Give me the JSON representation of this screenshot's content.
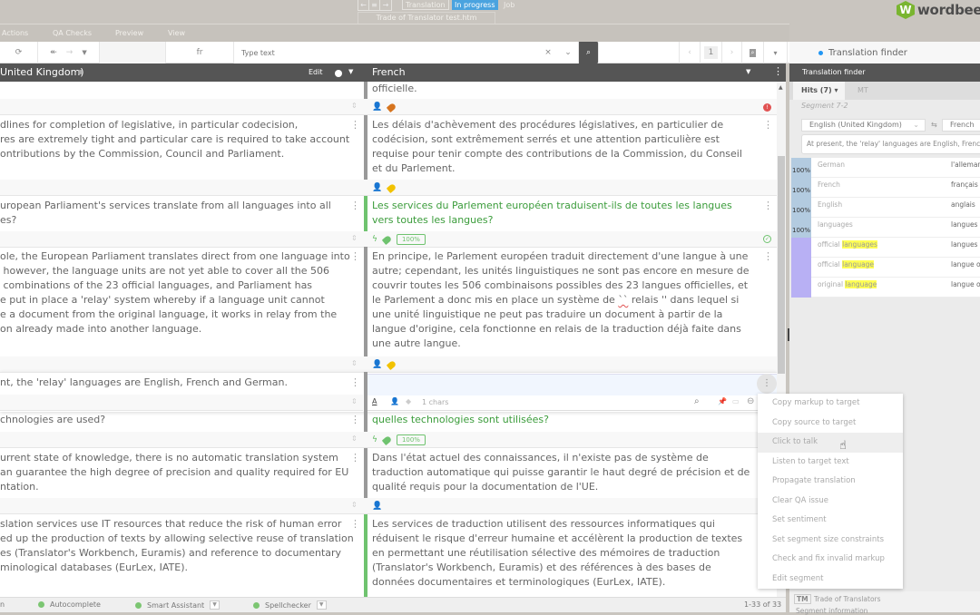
{
  "topbar": {
    "nav_prev": "←",
    "nav_list": "≡",
    "nav_next": "→",
    "workflow": "Translation",
    "status": "In progress",
    "job": "Job",
    "document_tab": "Trade of Translator test.htm",
    "logo_text": "wordbee",
    "logo_tm": "™"
  },
  "menu": [
    "Actions",
    "QA Checks",
    "Preview",
    "View"
  ],
  "toolbar": {
    "lang_code": "fr",
    "search_placeholder": "Type text",
    "clear": "×",
    "dropdown": "⌄",
    "search_icon": "🔍",
    "prev_page": "‹",
    "page": "1",
    "next_page": "›",
    "more": "▾"
  },
  "grid": {
    "source_header": "United Kingdom)",
    "edit_label": "Edit",
    "target_header": "French",
    "rows": [
      {
        "source": "",
        "target": "officielle.",
        "target_style": "normal",
        "footer": {
          "tag_color": "#d6741e",
          "status": "error"
        }
      },
      {
        "source": "dlines for completion of legislative, in particular codecision,\nres are extremely tight and particular care is required to take account\nontributions by the Commission, Council and Parliament.",
        "target": "Les délais d'achèvement des procédures législatives, en particulier de codécision, sont extrêmement serrés et une attention particulière est requise pour tenir compte des contributions de la Commission, du Conseil et du Parlement.",
        "target_style": "normal",
        "footer": {
          "tag_color": "#f2c200"
        }
      },
      {
        "source": "uropean Parliament's services translate from all languages into all\nes?",
        "target": "Les services du Parlement européen traduisent-ils de toutes les langues vers toutes les langues?",
        "target_style": "green",
        "footer": {
          "tag_color": "#6fc36f",
          "match": "100%",
          "status": "confirmed"
        }
      },
      {
        "source": "ole, the European Parliament translates direct from one language into\n however, the language units are not yet able to cover all the 506\n combinations of the 23 official languages, and Parliament has\ne put in place a 'relay' system whereby if a language unit cannot\ne a document from the original language, it works in relay from the\non already made into another language.",
        "target_pre": "En principe, le Parlement européen traduit directement d'une langue à une autre; cependant, les unités linguistiques ne sont pas encore en mesure de couvrir toutes les 506 combinaisons possibles des 23 langues officielles, et le Parlement a donc mis en place un système de ",
        "target_squig": "``",
        "target_post": " relais '' dans lequel si une unité linguistique ne peut pas traduire un document à partir de la langue d'origine, cela fonctionne en relais de la traduction déjà faite dans une autre langue.",
        "target_style": "normal",
        "footer": {
          "tag_color": "#f2c200"
        }
      },
      {
        "source": "nt, the 'relay' languages are English, French and German.",
        "target": "",
        "target_style": "editing",
        "footer": {
          "chars": "1 chars"
        }
      },
      {
        "source": "chnologies are used?",
        "target": "quelles technologies sont utilisées?",
        "target_style": "green",
        "footer": {
          "tag_color": "#6fc36f",
          "match": "100%"
        }
      },
      {
        "source": "urrent state of knowledge, there is no automatic translation system\nan guarantee the high degree of precision and quality required for EU\nntation.",
        "target": "Dans l'état actuel des connaissances, il n'existe pas de système de traduction automatique qui puisse garantir le haut degré de précision et de qualité requis pour la documentation de l'UE.",
        "target_style": "normal",
        "footer": {}
      },
      {
        "source": "slation services use IT resources that reduce the risk of human error\ned up the production of texts by allowing selective reuse of translation\nes (Translator's Workbench, Euramis) and reference to documentary\nminological databases (EurLex, IATE).",
        "target": "Les services de traduction utilisent des ressources informatiques qui réduisent le risque d'erreur humaine et accélèrent la production de textes en permettant une réutilisation sélective des mémoires de traduction (Translator's Workbench, Euramis) et des références à des bases de données documentaires et terminologiques (EurLex, IATE).",
        "target_style": "normal",
        "footer": {}
      }
    ]
  },
  "finder": {
    "tab_label": "Translation finder",
    "header": "Translation finder",
    "hits_tab": "Hits (7) ▾",
    "mt_tab": "MT",
    "segment": "Segment 7-2",
    "source_lang": "English (United Kingdom)",
    "target_lang": "French",
    "query": "At present, the 'relay' languages are English, French and German.",
    "hits": [
      {
        "score": "100%",
        "source": "German",
        "target": "l'allemand",
        "kind": "tm"
      },
      {
        "score": "100%",
        "source": "French",
        "target": "français",
        "kind": "tm"
      },
      {
        "score": "100%",
        "source": "English",
        "target": "anglais",
        "kind": "tm"
      },
      {
        "score": "100%",
        "source": "languages",
        "target": "langues",
        "kind": "tm"
      },
      {
        "score": "",
        "source_pre": "official ",
        "source_hl": "languages",
        "target": "langues o",
        "kind": "term"
      },
      {
        "score": "",
        "source_pre": "official ",
        "source_hl": "language",
        "target": "langue of",
        "kind": "term"
      },
      {
        "score": "",
        "source_pre": "original ",
        "source_hl": "language",
        "target": "langue o",
        "kind": "term"
      }
    ],
    "tm_badge": "TM",
    "tm_name": "Trade of Translators",
    "segment_info": "Segment information"
  },
  "context_menu": {
    "items": [
      "Copy markup to target",
      "Copy source to target",
      "Click to talk",
      "Listen to target text",
      "Propagate translation",
      "Clear QA issue",
      "Set sentiment",
      "Set segment size constraints",
      "Check and fix invalid markup",
      "Edit segment"
    ],
    "hovered": "Click to talk"
  },
  "statusbar": {
    "partial": "n",
    "autocomplete": "Autocomplete",
    "smart_assistant": "Smart Assistant",
    "spellchecker": "Spellchecker",
    "range": "1-33 of 33"
  }
}
